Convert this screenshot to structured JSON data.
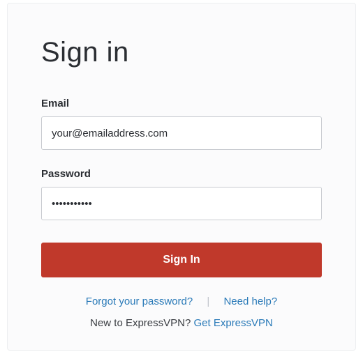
{
  "title": "Sign in",
  "email": {
    "label": "Email",
    "placeholder": "your@emailaddress.com"
  },
  "password": {
    "label": "Password",
    "value": "•••••••••••"
  },
  "submit_label": "Sign In",
  "links": {
    "forgot": "Forgot your password?",
    "help": "Need help?",
    "new_prompt": "New to ExpressVPN? ",
    "get": "Get ExpressVPN"
  }
}
